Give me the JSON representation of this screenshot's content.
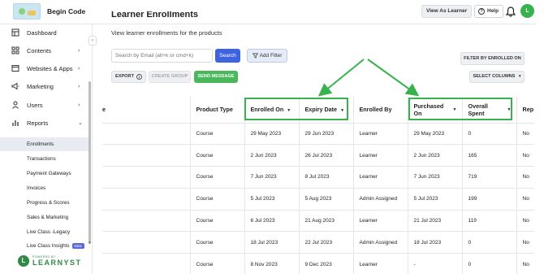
{
  "header": {
    "brand": "Begin Code",
    "view_as_learner": "View As Learner",
    "help": "Help",
    "avatar_initial": "L"
  },
  "sidebar": {
    "items": [
      {
        "label": "Dashboard",
        "icon": "dashboard-icon"
      },
      {
        "label": "Contents",
        "icon": "contents-icon"
      },
      {
        "label": "Websites & Apps",
        "icon": "website-icon"
      },
      {
        "label": "Marketing",
        "icon": "megaphone-icon"
      },
      {
        "label": "Users",
        "icon": "user-icon"
      },
      {
        "label": "Reports",
        "icon": "bar-chart-icon"
      }
    ],
    "subitems": [
      "Enrollments",
      "Transactions",
      "Payment Gateways",
      "Invoices",
      "Progress & Scores",
      "Sales & Marketing",
      "Live Class -Legacy",
      "Live Class Insights"
    ],
    "new_badge": "New",
    "powered_by": "POWERED BY",
    "powered_brand": "LEARNYST"
  },
  "page": {
    "title": "Learner Enrollments",
    "subtitle": "View learner enrollments for the products",
    "search_placeholder": "Search by Email (alt+k or cmd+k)",
    "search_button": "Search",
    "add_filter": "Add Filter",
    "filter_enrolled_on": "FILTER BY ENROLLED ON",
    "export": "EXPORT",
    "create_group": "CREATE GROUP",
    "send_message": "SEND MESSAGE",
    "select_columns": "SELECT COLUMNS"
  },
  "table": {
    "columns": [
      "e",
      "Product Type",
      "Enrolled On",
      "Expiry Date",
      "Enrolled By",
      "Purchased On",
      "Overall Spent",
      "Rep"
    ],
    "rows": [
      [
        "",
        "Course",
        "29 May 2023",
        "29 Jun 2023",
        "Learner",
        "29 May 2023",
        "0",
        "No"
      ],
      [
        "",
        "Course",
        "2 Jun 2023",
        "26 Jul 2023",
        "Learner",
        "2 Jun 2023",
        "165",
        "No"
      ],
      [
        "",
        "Course",
        "7 Jun 2023",
        "8 Jul 2023",
        "Learner",
        "7 Jun 2023",
        "719",
        "No"
      ],
      [
        "",
        "Course",
        "5 Jul 2023",
        "5 Aug 2023",
        "Admin Assigned",
        "5 Jul 2023",
        "199",
        "No"
      ],
      [
        "",
        "Course",
        "6 Jul 2023",
        "21 Aug 2023",
        "Learner",
        "21 Jul 2023",
        "119",
        "No"
      ],
      [
        "",
        "Course",
        "18 Jul 2023",
        "22 Jul 2023",
        "Admin Assigned",
        "18 Jul 2023",
        "0",
        "No"
      ],
      [
        "",
        "Course",
        "8 Nov 2023",
        "9 Dec 2023",
        "Learner",
        "-",
        "0",
        "No"
      ]
    ]
  },
  "colors": {
    "accent_blue": "#3f63e0",
    "accent_green": "#48b85a",
    "highlight_green": "#37b24d"
  }
}
